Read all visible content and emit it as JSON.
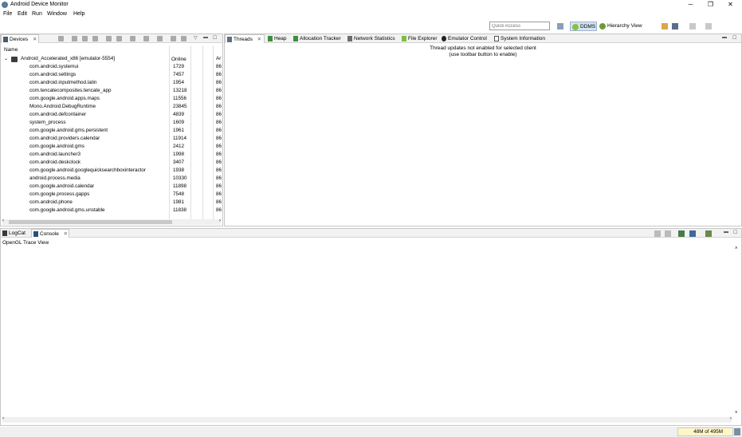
{
  "window": {
    "title": "Android Device Monitor",
    "controls": {
      "minimize": "─",
      "restore": "❐",
      "close": "✕"
    }
  },
  "menu": [
    "File",
    "Edit",
    "Run",
    "Window",
    "Help"
  ],
  "toolbar": {
    "quick_access_placeholder": "Quick Access",
    "perspectives": [
      {
        "label": "DDMS",
        "icon": "android-icon",
        "active": true
      },
      {
        "label": "Hierarchy View",
        "icon": "hierarchy-icon",
        "active": false
      }
    ]
  },
  "devices_panel": {
    "tab": "Devices",
    "columns": {
      "name": "Name",
      "pid": "Online",
      "port": "Ar"
    },
    "device": {
      "name": "Android_Accelerated_x86 [emulator-5554]",
      "status": "Online",
      "port": "Ar"
    },
    "processes": [
      {
        "name": "com.android.systemui",
        "pid": "1729",
        "port": "86"
      },
      {
        "name": "com.android.settings",
        "pid": "7457",
        "port": "86"
      },
      {
        "name": "com.android.inputmethod.latin",
        "pid": "1954",
        "port": "86"
      },
      {
        "name": "com.tencatecomposites.tencate_app",
        "pid": "13218",
        "port": "86"
      },
      {
        "name": "com.google.android.apps.maps",
        "pid": "11556",
        "port": "86"
      },
      {
        "name": "Mono.Android.DebugRuntime",
        "pid": "23845",
        "port": "86"
      },
      {
        "name": "com.android.defcontainer",
        "pid": "4839",
        "port": "86"
      },
      {
        "name": "system_process",
        "pid": "1609",
        "port": "86"
      },
      {
        "name": "com.google.android.gms.persistent",
        "pid": "1961",
        "port": "86"
      },
      {
        "name": "com.android.providers.calendar",
        "pid": "11914",
        "port": "86"
      },
      {
        "name": "com.google.android.gms",
        "pid": "2412",
        "port": "86"
      },
      {
        "name": "com.android.launcher3",
        "pid": "1998",
        "port": "86"
      },
      {
        "name": "com.android.deskclock",
        "pid": "3407",
        "port": "86"
      },
      {
        "name": "com.google.android.googlequicksearchboxinteractor",
        "pid": "1938",
        "port": "86"
      },
      {
        "name": "android.process.media",
        "pid": "10330",
        "port": "86"
      },
      {
        "name": "com.google.android.calendar",
        "pid": "11898",
        "port": "86"
      },
      {
        "name": "com.google.process.gapps",
        "pid": "7548",
        "port": "86"
      },
      {
        "name": "com.android.phone",
        "pid": "1981",
        "port": "86"
      },
      {
        "name": "com.google.android.gms.unstable",
        "pid": "11838",
        "port": "86"
      }
    ]
  },
  "tools_panel": {
    "tabs": [
      "Threads",
      "Heap",
      "Allocation Tracker",
      "Network Statistics",
      "File Explorer",
      "Emulator Control",
      "System Information"
    ],
    "message_line1": "Thread updates not enabled for selected client",
    "message_line2": "(use toolbar button to enable)"
  },
  "console_panel": {
    "tabs": [
      "LogCat",
      "Console"
    ],
    "label": "OpenGL Trace View"
  },
  "status": {
    "heap": "48M of 495M"
  },
  "colors": {
    "active_perspective": "#d5e3f0",
    "heap_bg": "#fdf6c8",
    "panel_border": "#c6c6c6"
  }
}
